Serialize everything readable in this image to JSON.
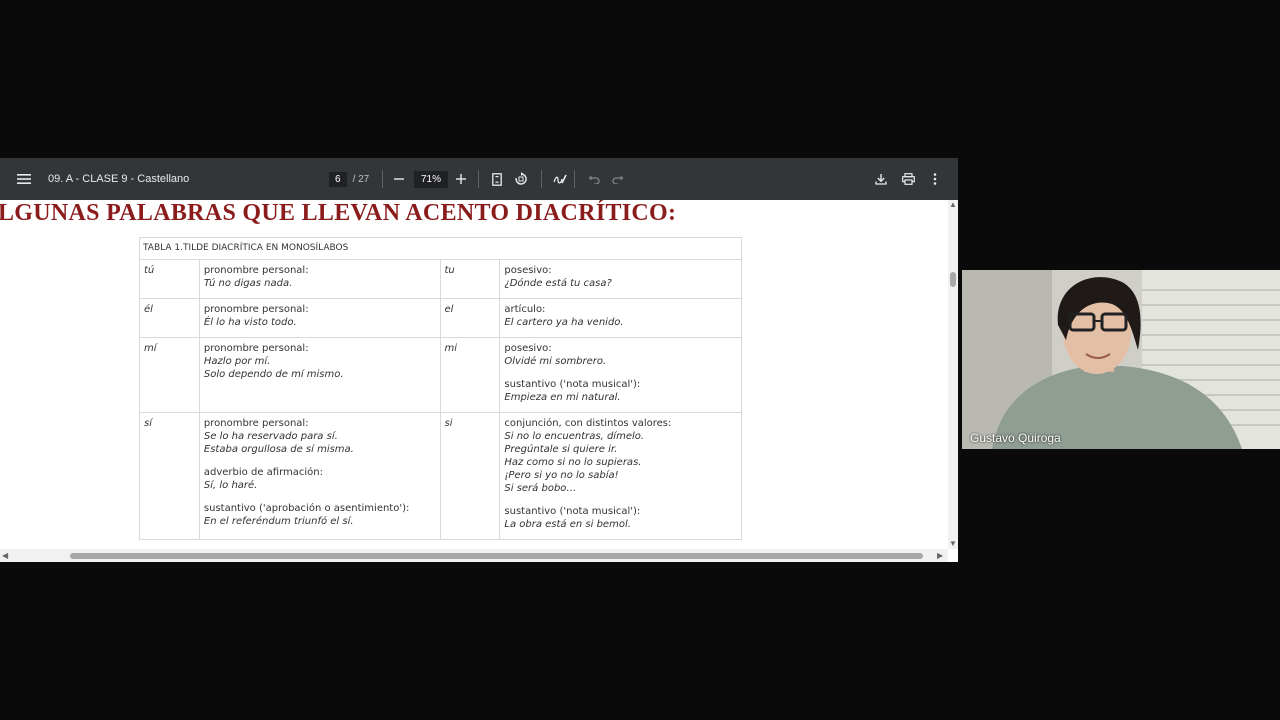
{
  "toolbar": {
    "menu_icon": "menu-icon",
    "doc_title": "09. A - CLASE 9 - Castellano",
    "page_current": "6",
    "page_total": "/ 27",
    "zoom_value": "71%",
    "icons": [
      "minus-icon",
      "plus-icon",
      "fit-page-icon",
      "rotate-icon",
      "annotate-icon",
      "undo-icon",
      "redo-icon",
      "download-icon",
      "print-icon",
      "more-icon"
    ]
  },
  "document": {
    "heading": "LGUNAS PALABRAS QUE LLEVAN ACENTO DIACRÍTICO:",
    "table": {
      "caption": "TABLA 1.TILDE DIACRÍTICA EN MONOSÍLABOS",
      "rows": [
        {
          "w1": "tú",
          "d1": [
            {
              "label": "pronombre personal:",
              "ex": [
                "Tú no digas nada."
              ]
            }
          ],
          "w2": "tu",
          "d2": [
            {
              "label": "posesivo:",
              "ex": [
                "¿Dónde está tu casa?"
              ]
            }
          ]
        },
        {
          "w1": "él",
          "d1": [
            {
              "label": "pronombre personal:",
              "ex": [
                "Él lo ha visto todo."
              ]
            }
          ],
          "w2": "el",
          "d2": [
            {
              "label": "artículo:",
              "ex": [
                "El cartero ya ha venido."
              ]
            }
          ]
        },
        {
          "w1": "mí",
          "d1": [
            {
              "label": "pronombre personal:",
              "ex": [
                "Hazlo por mí.",
                "Solo dependo de mí mismo."
              ]
            }
          ],
          "w2": "mi",
          "d2": [
            {
              "label": "posesivo:",
              "ex": [
                "Olvidé mi sombrero."
              ]
            },
            {
              "label": "sustantivo ('nota musical'):",
              "ex": [
                "Empieza en mi natural."
              ]
            }
          ]
        },
        {
          "w1": "sí",
          "d1": [
            {
              "label": "pronombre personal:",
              "ex": [
                "Se lo ha reservado para sí.",
                "Estaba orgullosa de sí misma."
              ]
            },
            {
              "label": "adverbio de afirmación:",
              "ex": [
                "Sí, lo haré."
              ]
            },
            {
              "label": "sustantivo ('aprobación o asentimiento'):",
              "ex": [
                "En el referéndum triunfó el sí."
              ]
            }
          ],
          "w2": "si",
          "d2": [
            {
              "label": "conjunción, con distintos valores:",
              "ex": [
                "Si no lo encuentras, dímelo.",
                "Pregúntale si quiere ir.",
                "Haz como si no lo supieras.",
                "¡Pero si yo no lo sabía!",
                "Si será bobo…"
              ]
            },
            {
              "label": "sustantivo ('nota musical'):",
              "ex": [
                "La obra está en si bemol."
              ]
            }
          ]
        }
      ]
    }
  },
  "video": {
    "participant_name": "Gustavo Quiroga"
  },
  "colors": {
    "toolbar_bg": "#323639",
    "heading": "#8b1c1c",
    "background": "#0a0a0a"
  }
}
